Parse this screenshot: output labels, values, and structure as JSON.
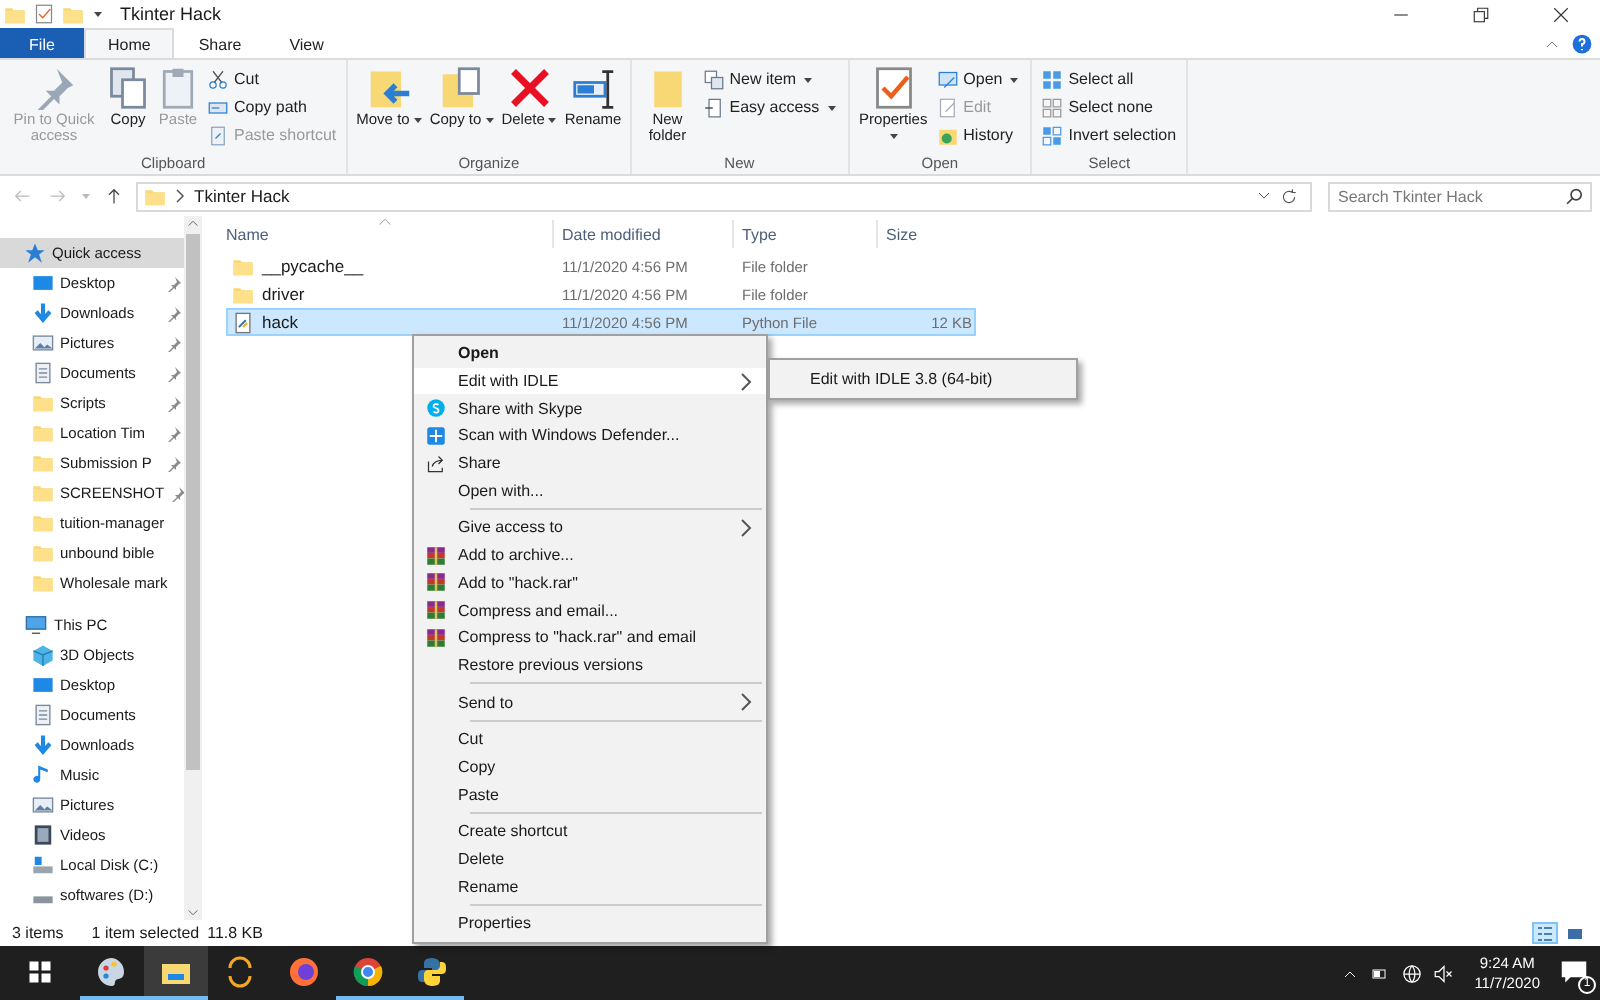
{
  "window": {
    "title": "Tkinter Hack"
  },
  "ribbon_tabs": [
    {
      "label": "File",
      "kind": "file",
      "selected": false
    },
    {
      "label": "Home",
      "kind": "tab",
      "selected": true
    },
    {
      "label": "Share",
      "kind": "tab",
      "selected": false
    },
    {
      "label": "View",
      "kind": "tab",
      "selected": false
    }
  ],
  "ribbon_groups": [
    {
      "label": "Clipboard",
      "buttons": [
        {
          "kind": "large",
          "label": "Pin to Quick access",
          "disabled": true,
          "dropdown": false
        },
        {
          "kind": "large",
          "label": "Copy",
          "disabled": false,
          "dropdown": false
        },
        {
          "kind": "large",
          "label": "Paste",
          "disabled": true,
          "dropdown": false
        },
        {
          "kind": "small",
          "label": "Cut",
          "disabled": false,
          "dropdown": false
        },
        {
          "kind": "small",
          "label": "Copy path",
          "disabled": false,
          "dropdown": false
        },
        {
          "kind": "small",
          "label": "Paste shortcut",
          "disabled": true,
          "dropdown": false
        }
      ]
    },
    {
      "label": "Organize",
      "buttons": [
        {
          "kind": "large",
          "label": "Move to",
          "disabled": false,
          "dropdown": true
        },
        {
          "kind": "large",
          "label": "Copy to",
          "disabled": false,
          "dropdown": true
        },
        {
          "kind": "large",
          "label": "Delete",
          "disabled": false,
          "dropdown": true
        },
        {
          "kind": "large",
          "label": "Rename",
          "disabled": false,
          "dropdown": false
        }
      ]
    },
    {
      "label": "New",
      "buttons": [
        {
          "kind": "large",
          "label": "New folder",
          "disabled": false,
          "dropdown": false
        },
        {
          "kind": "small",
          "label": "New item",
          "disabled": false,
          "dropdown": true
        },
        {
          "kind": "small",
          "label": "Easy access",
          "disabled": false,
          "dropdown": true
        }
      ]
    },
    {
      "label": "Open",
      "buttons": [
        {
          "kind": "large",
          "label": "Properties",
          "disabled": false,
          "dropdown": true
        },
        {
          "kind": "small",
          "label": "Open",
          "disabled": false,
          "dropdown": true
        },
        {
          "kind": "small",
          "label": "Edit",
          "disabled": true,
          "dropdown": false
        },
        {
          "kind": "small",
          "label": "History",
          "disabled": false,
          "dropdown": false
        }
      ]
    },
    {
      "label": "Select",
      "buttons": [
        {
          "kind": "small",
          "label": "Select all",
          "disabled": false,
          "dropdown": false
        },
        {
          "kind": "small",
          "label": "Select none",
          "disabled": false,
          "dropdown": false
        },
        {
          "kind": "small",
          "label": "Invert selection",
          "disabled": false,
          "dropdown": false
        }
      ]
    }
  ],
  "address": {
    "path": [
      "Tkinter Hack"
    ],
    "search_placeholder": "Search Tkinter Hack"
  },
  "sidebar": {
    "items": [
      {
        "label": "Quick access",
        "selected": true,
        "children": [
          {
            "label": "Desktop",
            "pinned": true
          },
          {
            "label": "Downloads",
            "pinned": true
          },
          {
            "label": "Pictures",
            "pinned": true
          },
          {
            "label": "Documents",
            "pinned": true
          },
          {
            "label": "Scripts",
            "pinned": true
          },
          {
            "label": "Location  Tim",
            "pinned": true
          },
          {
            "label": "Submission P",
            "pinned": true
          },
          {
            "label": "SCREENSHOT",
            "pinned": true
          },
          {
            "label": "tuition-manager",
            "pinned": false
          },
          {
            "label": "unbound bible",
            "pinned": false
          },
          {
            "label": "Wholesale mark",
            "pinned": false
          }
        ]
      },
      {
        "label": "This PC",
        "selected": false,
        "children": [
          {
            "label": "3D Objects",
            "pinned": false
          },
          {
            "label": "Desktop",
            "pinned": false
          },
          {
            "label": "Documents",
            "pinned": false
          },
          {
            "label": "Downloads",
            "pinned": false
          },
          {
            "label": "Music",
            "pinned": false
          },
          {
            "label": "Pictures",
            "pinned": false
          },
          {
            "label": "Videos",
            "pinned": false
          },
          {
            "label": "Local Disk (C:)",
            "pinned": false
          },
          {
            "label": "softwares (D:)",
            "pinned": false
          }
        ]
      }
    ]
  },
  "table": {
    "columns": [
      "Name",
      "Date modified",
      "Type",
      "Size"
    ],
    "rows": [
      {
        "kind": "folder",
        "name": "__pycache__",
        "date": "11/1/2020 4:56 PM",
        "type": "File folder",
        "size": null,
        "selected": false
      },
      {
        "kind": "folder",
        "name": "driver",
        "date": "11/1/2020 4:56 PM",
        "type": "File folder",
        "size": null,
        "selected": false
      },
      {
        "kind": "file",
        "name": "hack",
        "date": "11/1/2020 4:56 PM",
        "type": "Python File",
        "size": "12 KB",
        "selected": true
      }
    ]
  },
  "context_menu": {
    "items": [
      {
        "kind": "item",
        "label": "Open",
        "default": true,
        "selected": false
      },
      {
        "kind": "submenu",
        "label": "Edit with IDLE",
        "default": false,
        "selected": true
      },
      {
        "kind": "item",
        "label": "Share with Skype",
        "default": false,
        "selected": false
      },
      {
        "kind": "item",
        "label": "Scan with Windows Defender...",
        "default": false,
        "selected": false
      },
      {
        "kind": "item",
        "label": "Share",
        "default": false,
        "selected": false
      },
      {
        "kind": "item",
        "label": "Open with...",
        "default": false,
        "selected": false
      },
      {
        "kind": "separator"
      },
      {
        "kind": "submenu",
        "label": "Give access to",
        "default": false,
        "selected": false
      },
      {
        "kind": "item",
        "label": "Add to archive...",
        "default": false,
        "selected": false
      },
      {
        "kind": "item",
        "label": "Add to \"hack.rar\"",
        "default": false,
        "selected": false
      },
      {
        "kind": "item",
        "label": "Compress and email...",
        "default": false,
        "selected": false
      },
      {
        "kind": "item",
        "label": "Compress to \"hack.rar\" and email",
        "default": false,
        "selected": false
      },
      {
        "kind": "item",
        "label": "Restore previous versions",
        "default": false,
        "selected": false
      },
      {
        "kind": "separator"
      },
      {
        "kind": "submenu",
        "label": "Send to",
        "default": false,
        "selected": false
      },
      {
        "kind": "separator"
      },
      {
        "kind": "item",
        "label": "Cut",
        "default": false,
        "selected": false
      },
      {
        "kind": "item",
        "label": "Copy",
        "default": false,
        "selected": false
      },
      {
        "kind": "item",
        "label": "Paste",
        "default": false,
        "selected": false
      },
      {
        "kind": "separator"
      },
      {
        "kind": "item",
        "label": "Create shortcut",
        "default": false,
        "selected": false
      },
      {
        "kind": "item",
        "label": "Delete",
        "default": false,
        "selected": false
      },
      {
        "kind": "item",
        "label": "Rename",
        "default": false,
        "selected": false
      },
      {
        "kind": "separator"
      },
      {
        "kind": "item",
        "label": "Properties",
        "default": false,
        "selected": false
      }
    ],
    "submenu": {
      "items": [
        "Edit with IDLE 3.8 (64-bit)"
      ]
    }
  },
  "status_bar": {
    "count": "3 items",
    "selection": "1 item selected",
    "size": "11.8 KB",
    "views": [
      {
        "selected": true
      },
      {
        "selected": false
      }
    ]
  },
  "taskbar": {
    "apps": [
      {
        "running": true,
        "selected": false
      },
      {
        "running": true,
        "selected": true
      },
      {
        "running": false,
        "selected": false
      },
      {
        "running": false,
        "selected": false
      },
      {
        "running": true,
        "selected": false
      },
      {
        "running": true,
        "selected": false
      }
    ],
    "time": "9:24 AM",
    "date": "11/7/2020",
    "notifications": "1"
  }
}
